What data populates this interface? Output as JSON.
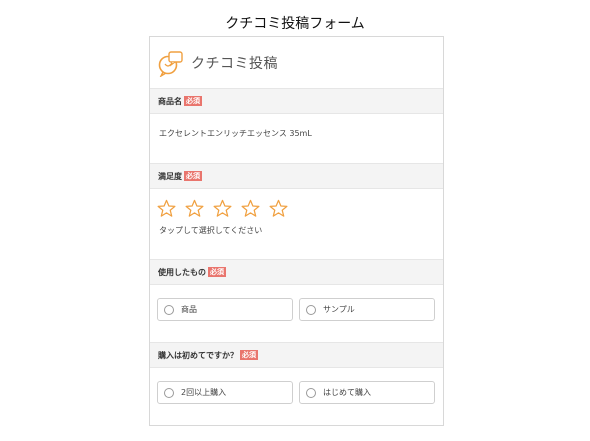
{
  "page_title": "クチコミ投稿フォーム",
  "form": {
    "title": "クチコミ投稿",
    "required_badge": "必須",
    "sections": {
      "product": {
        "label": "商品名",
        "value": "エクセレントエンリッチエッセンス 35mL"
      },
      "rating": {
        "label": "満足度",
        "star_count": 5,
        "hint": "タップして選択してください"
      },
      "used": {
        "label": "使用したもの",
        "options": [
          "商品",
          "サンプル"
        ]
      },
      "first_purchase": {
        "label": "購入は初めてですか？",
        "options": [
          "2回以上購入",
          "はじめて購入"
        ]
      }
    }
  },
  "colors": {
    "accent": "#e9756d",
    "star": "#f0a040",
    "section_bg": "#f4f4f4"
  },
  "icons": {
    "logo": "chat-bubble-logo-icon",
    "star": "star-outline-icon",
    "radio": "radio-unchecked-icon"
  }
}
